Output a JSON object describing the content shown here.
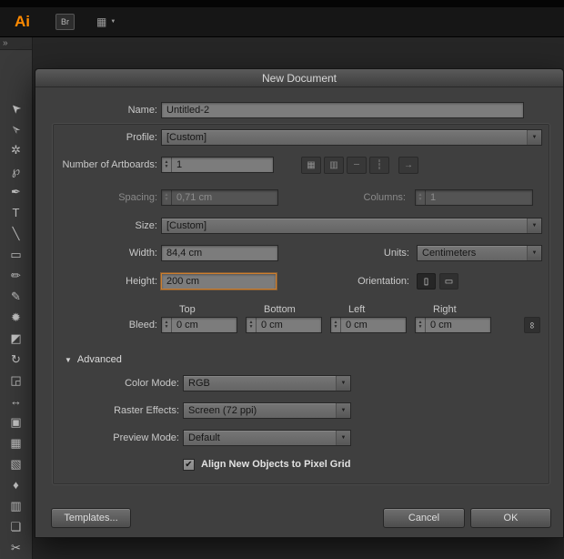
{
  "appbar": {
    "logo": "Ai",
    "bridge_label": "Br"
  },
  "icons": {
    "dropdown_arrow": "▼",
    "spin_up": "▲",
    "spin_down": "▼",
    "check": "✔",
    "link": "∞",
    "advanced_triangle": "▼",
    "collapse_chevrons": "»",
    "portrait": "▯",
    "landscape": "▭",
    "grid_by_row": "▦",
    "grid_by_column": "▥",
    "arrange_by_row": "┄",
    "arrange_by_column": "┆",
    "layout_direction": "→",
    "documents_grid": "▦"
  },
  "toolbar": {
    "tools": [
      {
        "name": "selection-tool",
        "glyph": "➤"
      },
      {
        "name": "direct-selection-tool",
        "glyph": "➢"
      },
      {
        "name": "magic-wand-tool",
        "glyph": "✲"
      },
      {
        "name": "lasso-tool",
        "glyph": "℘"
      },
      {
        "name": "pen-tool",
        "glyph": "✒"
      },
      {
        "name": "type-tool",
        "glyph": "T"
      },
      {
        "name": "line-segment-tool",
        "glyph": "╲"
      },
      {
        "name": "rectangle-tool",
        "glyph": "▭"
      },
      {
        "name": "paintbrush-tool",
        "glyph": "✏"
      },
      {
        "name": "pencil-tool",
        "glyph": "✎"
      },
      {
        "name": "blob-brush-tool",
        "glyph": "✹"
      },
      {
        "name": "eraser-tool",
        "glyph": "◩"
      },
      {
        "name": "rotate-tool",
        "glyph": "↻"
      },
      {
        "name": "scale-tool",
        "glyph": "◲"
      },
      {
        "name": "width-tool",
        "glyph": "↔"
      },
      {
        "name": "shape-builder-tool",
        "glyph": "▣"
      },
      {
        "name": "mesh-tool",
        "glyph": "▦"
      },
      {
        "name": "gradient-tool",
        "glyph": "▧"
      },
      {
        "name": "eyedropper-tool",
        "glyph": "♦"
      },
      {
        "name": "column-graph-tool",
        "glyph": "▥"
      },
      {
        "name": "artboard-tool",
        "glyph": "❏"
      },
      {
        "name": "slice-tool",
        "glyph": "✂"
      }
    ]
  },
  "dialog": {
    "title": "New Document",
    "name": {
      "label": "Name:",
      "value": "Untitled-2"
    },
    "profile": {
      "label": "Profile:",
      "value": "[Custom]"
    },
    "artboards": {
      "label": "Number of Artboards:",
      "value": "1"
    },
    "spacing": {
      "label": "Spacing:",
      "value": "0,71 cm"
    },
    "columns": {
      "label": "Columns:",
      "value": "1"
    },
    "size": {
      "label": "Size:",
      "value": "[Custom]"
    },
    "width": {
      "label": "Width:",
      "value": "84,4 cm"
    },
    "units": {
      "label": "Units:",
      "value": "Centimeters"
    },
    "height": {
      "label": "Height:",
      "value": "200 cm"
    },
    "orientation_label": "Orientation:",
    "bleed": {
      "label": "Bleed:",
      "columns": [
        "Top",
        "Bottom",
        "Left",
        "Right"
      ],
      "values": [
        "0 cm",
        "0 cm",
        "0 cm",
        "0 cm"
      ]
    },
    "advanced": {
      "label": "Advanced",
      "color_mode": {
        "label": "Color Mode:",
        "value": "RGB"
      },
      "raster_effects": {
        "label": "Raster Effects:",
        "value": "Screen (72 ppi)"
      },
      "preview_mode": {
        "label": "Preview Mode:",
        "value": "Default"
      },
      "pixel_grid": {
        "label": "Align New Objects to Pixel Grid",
        "checked": true
      }
    },
    "buttons": {
      "templates": "Templates...",
      "cancel": "Cancel",
      "ok": "OK"
    }
  },
  "colors": {
    "focus_orange": "#d08231",
    "logo_orange": "#ff8a00",
    "dialog_bg": "#3f3f3f"
  }
}
